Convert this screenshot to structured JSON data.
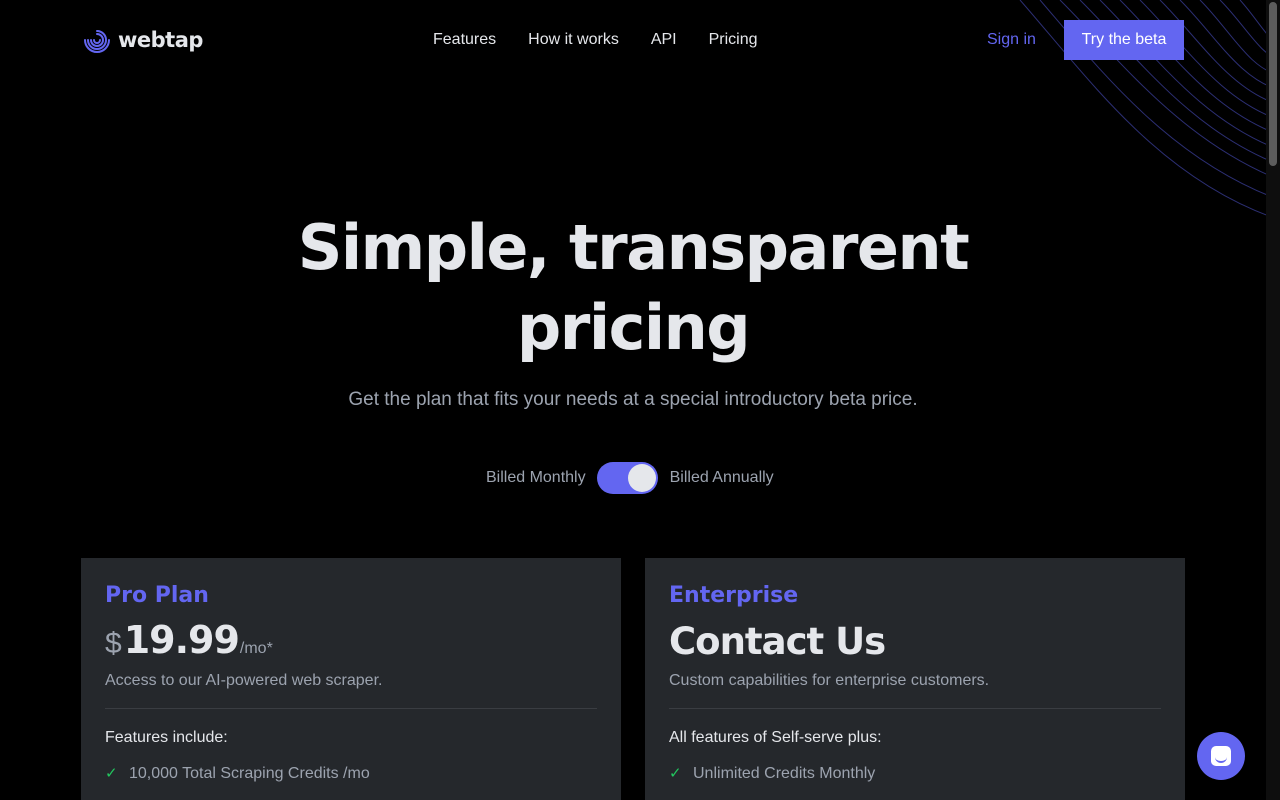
{
  "brand": {
    "name": "webtap",
    "logo_icon": "spiral-logo-icon",
    "accent": "#6366f1"
  },
  "nav": {
    "items": [
      "Features",
      "How it works",
      "API",
      "Pricing"
    ]
  },
  "header": {
    "signin_label": "Sign in",
    "cta_label": "Try the beta"
  },
  "hero": {
    "title_line1": "Simple, transparent",
    "title_line2": "pricing",
    "subtitle": "Get the plan that fits your needs at a special introductory beta price."
  },
  "billing": {
    "monthly_label": "Billed Monthly",
    "annual_label": "Billed Annually",
    "annual_selected": true
  },
  "plans": {
    "pro": {
      "name": "Pro Plan",
      "currency": "$",
      "price": "19.99",
      "period": "/mo*",
      "description": "Access to our AI-powered web scraper.",
      "features_heading": "Features include:",
      "features": [
        "10,000 Total Scraping Credits /mo"
      ]
    },
    "enterprise": {
      "name": "Enterprise",
      "headline": "Contact Us",
      "description": "Custom capabilities for enterprise customers.",
      "features_heading": "All features of Self-serve plus:",
      "features": [
        "Unlimited Credits Monthly"
      ]
    }
  },
  "colors": {
    "background": "#000000",
    "card": "#25282c",
    "check": "#22c55e",
    "muted": "#9ca3af"
  }
}
